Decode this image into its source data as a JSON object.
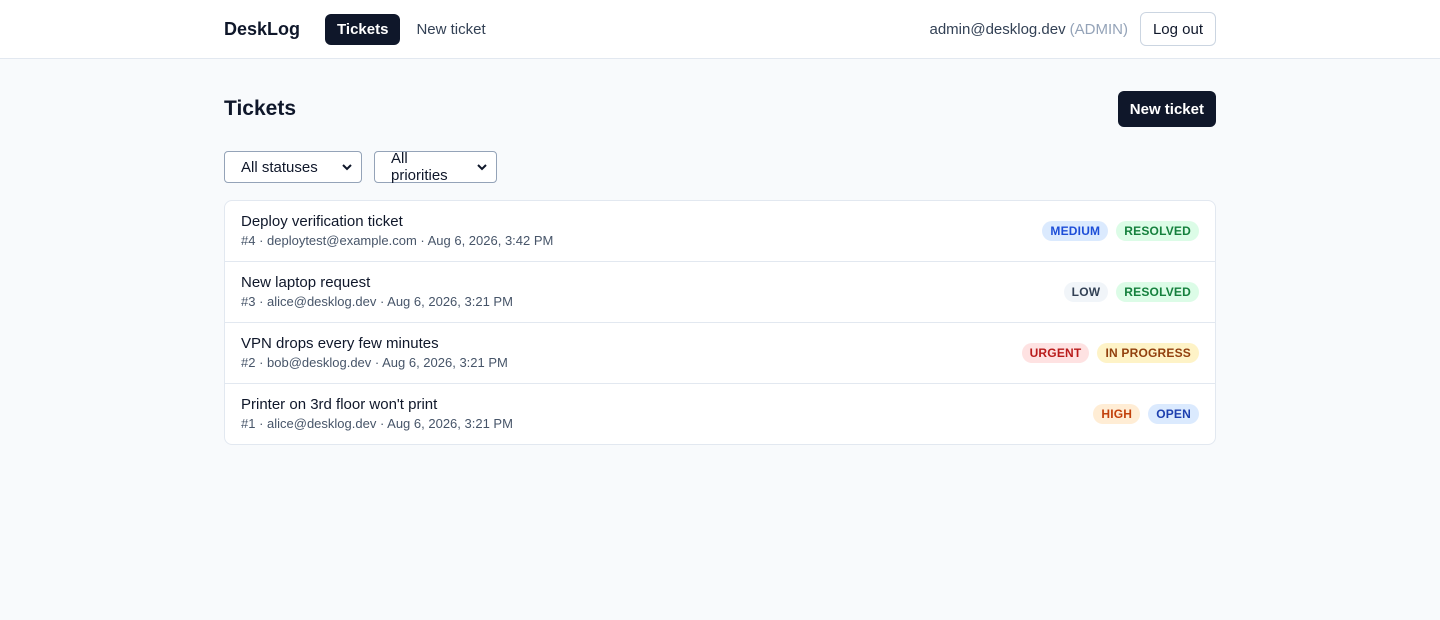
{
  "header": {
    "brand": "DeskLog",
    "nav": [
      {
        "label": "Tickets",
        "active": true
      },
      {
        "label": "New ticket",
        "active": false
      }
    ],
    "user_email": "admin@desklog.dev",
    "user_role": "(ADMIN)",
    "logout_label": "Log out"
  },
  "page": {
    "title": "Tickets",
    "new_ticket_label": "New ticket"
  },
  "filters": {
    "status_selected": "All statuses",
    "priority_selected": "All priorities"
  },
  "tickets": [
    {
      "title": "Deploy verification ticket",
      "meta": "#4 · deploytest@example.com · Aug 6, 2026, 3:42 PM",
      "priority": "MEDIUM",
      "status": "RESOLVED"
    },
    {
      "title": "New laptop request",
      "meta": "#3 · alice@desklog.dev · Aug 6, 2026, 3:21 PM",
      "priority": "LOW",
      "status": "RESOLVED"
    },
    {
      "title": "VPN drops every few minutes",
      "meta": "#2 · bob@desklog.dev · Aug 6, 2026, 3:21 PM",
      "priority": "URGENT",
      "status": "IN PROGRESS"
    },
    {
      "title": "Printer on 3rd floor won't print",
      "meta": "#1 · alice@desklog.dev · Aug 6, 2026, 3:21 PM",
      "priority": "HIGH",
      "status": "OPEN"
    }
  ],
  "colors": {
    "primary": "#0f172a",
    "background": "#f8fafc"
  }
}
